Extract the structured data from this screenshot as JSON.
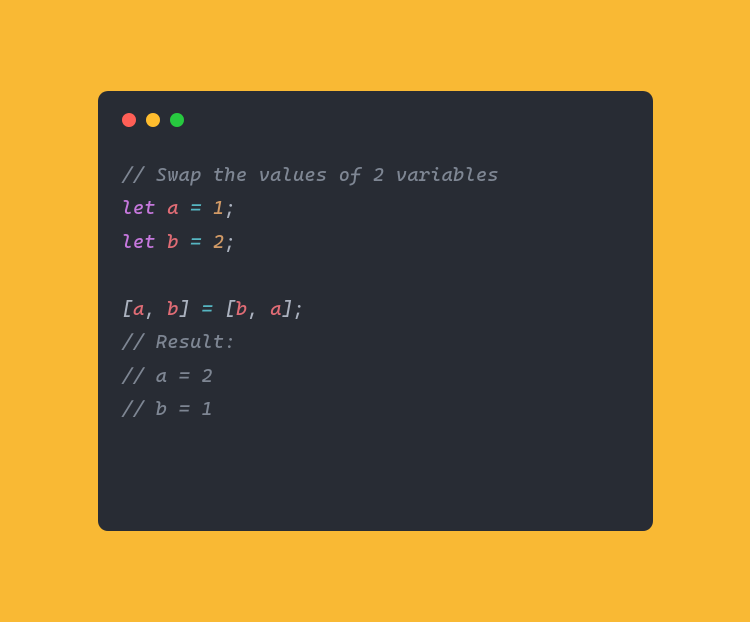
{
  "window": {
    "trafficLights": {
      "red": "#ff5f56",
      "yellow": "#ffbd2e",
      "green": "#27c93f"
    }
  },
  "code": {
    "comment1": "// Swap the values of 2 variables",
    "letKw1": "let",
    "sp": " ",
    "varA1": "a",
    "eq1": " = ",
    "num1": "1",
    "semi1": ";",
    "letKw2": "let",
    "varB1": "b",
    "eq2": " = ",
    "num2": "2",
    "semi2": ";",
    "lbracket": "[",
    "varA2": "a",
    "comma1": ", ",
    "varB2": "b",
    "rbracket": "]",
    "eq3": " = ",
    "lbracket2": "[",
    "varB3": "b",
    "comma2": ", ",
    "varA3": "a",
    "rbracket2": "];",
    "comment2": "// Result:",
    "comment3": "// a = 2",
    "comment4": "// b = 1"
  }
}
